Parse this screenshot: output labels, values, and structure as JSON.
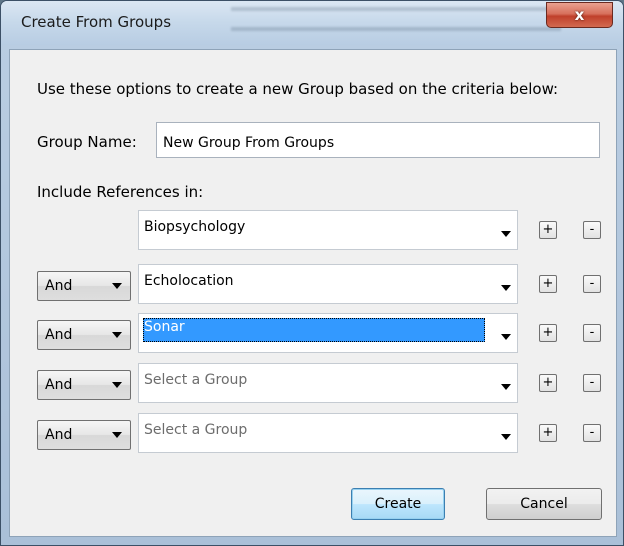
{
  "window": {
    "title": "Create From Groups",
    "close_glyph": "x"
  },
  "intro_text": "Use these options to create a new Group based on the criteria below:",
  "group_name": {
    "label": "Group Name:",
    "value": "New Group From Groups"
  },
  "include_label": "Include References in:",
  "rows": [
    {
      "operator": "",
      "group": "Biopsychology",
      "placeholder": false,
      "selected": false
    },
    {
      "operator": "And",
      "group": "Echolocation",
      "placeholder": false,
      "selected": false
    },
    {
      "operator": "And",
      "group": "Sonar",
      "placeholder": false,
      "selected": true
    },
    {
      "operator": "And",
      "group": "Select a Group",
      "placeholder": true,
      "selected": false
    },
    {
      "operator": "And",
      "group": "Select a Group",
      "placeholder": true,
      "selected": false
    }
  ],
  "add_label": "+",
  "remove_label": "-",
  "buttons": {
    "create": "Create",
    "cancel": "Cancel"
  },
  "colors": {
    "selection": "#3399ff",
    "dialog_bg": "#f0f0f0",
    "close_button": "#c0402b"
  },
  "icons": {
    "dropdown": "chevron-down-icon",
    "close": "close-icon"
  }
}
